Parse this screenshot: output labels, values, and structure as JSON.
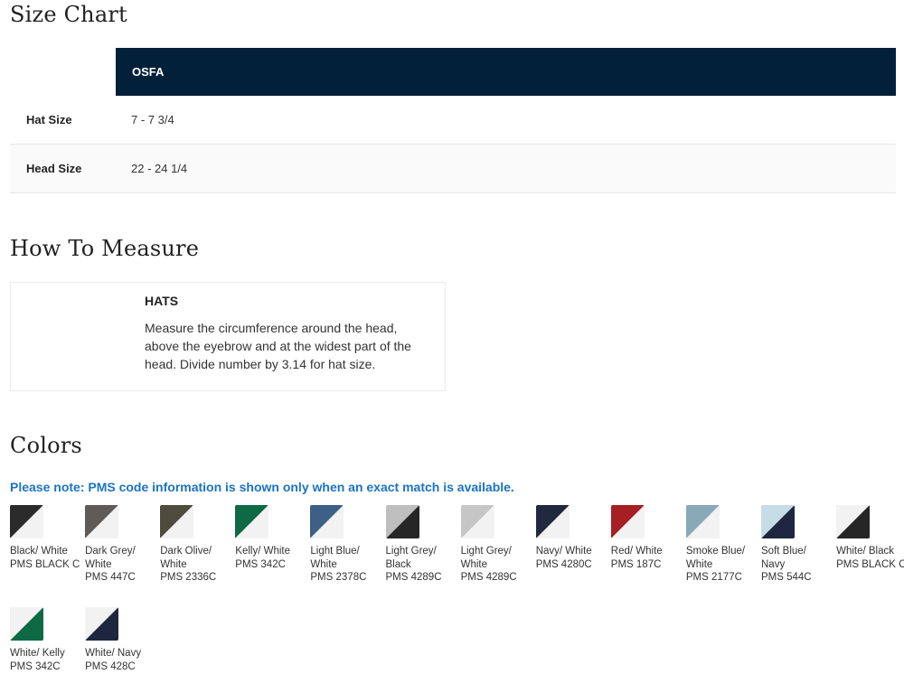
{
  "size_chart": {
    "title": "Size Chart",
    "column_header": "OSFA",
    "rows": [
      {
        "label": "Hat Size",
        "value": "7 - 7 3/4"
      },
      {
        "label": "Head Size",
        "value": "22 - 24 1/4"
      }
    ]
  },
  "how_to_measure": {
    "title": "How To Measure",
    "heading": "HATS",
    "text": "Measure the circumference around the head, above the eyebrow and at the widest part of the head. Divide number by 3.14 for hat size."
  },
  "colors": {
    "title": "Colors",
    "note": "Please note: PMS code information is shown only when an exact match is available.",
    "swatches": [
      {
        "name": "Black/ White",
        "pms": "PMS BLACK C",
        "c1": "#2b2b2b",
        "c2": "#f2f2f2"
      },
      {
        "name": "Dark Grey/ White",
        "pms": "PMS 447C",
        "c1": "#5f5b58",
        "c2": "#f2f2f2"
      },
      {
        "name": "Dark Olive/ White",
        "pms": "PMS 2336C",
        "c1": "#4e4c3d",
        "c2": "#f2f2f2"
      },
      {
        "name": "Kelly/ White",
        "pms": "PMS 342C",
        "c1": "#0e6a45",
        "c2": "#f2f2f2"
      },
      {
        "name": "Light Blue/ White",
        "pms": "PMS 2378C",
        "c1": "#3e5f86",
        "c2": "#f2f2f2"
      },
      {
        "name": "Light Grey/ Black",
        "pms": "PMS 4289C",
        "c1": "#bfbfbf",
        "c2": "#262626"
      },
      {
        "name": "Light Grey/ White",
        "pms": "PMS 4289C",
        "c1": "#c6c6c6",
        "c2": "#f2f2f2"
      },
      {
        "name": "Navy/ White",
        "pms": "PMS 4280C",
        "c1": "#22283d",
        "c2": "#f2f2f2"
      },
      {
        "name": "Red/ White",
        "pms": "PMS 187C",
        "c1": "#a51f24",
        "c2": "#f2f2f2"
      },
      {
        "name": "Smoke Blue/ White",
        "pms": "PMS 2177C",
        "c1": "#88a9b8",
        "c2": "#f2f2f2"
      },
      {
        "name": "Soft Blue/ Navy",
        "pms": "PMS 544C",
        "c1": "#c6dde8",
        "c2": "#1f2740"
      },
      {
        "name": "White/ Black",
        "pms": "PMS BLACK C",
        "c1": "#f2f2f2",
        "c2": "#262626"
      },
      {
        "name": "White/ Kelly",
        "pms": "PMS 342C",
        "c1": "#f2f2f2",
        "c2": "#0e6a45"
      },
      {
        "name": "White/ Navy",
        "pms": "PMS 428C",
        "c1": "#f2f2f2",
        "c2": "#1f2740"
      }
    ]
  },
  "theme": {
    "header_bg": "#02203a",
    "note_color": "#1a73c8"
  }
}
